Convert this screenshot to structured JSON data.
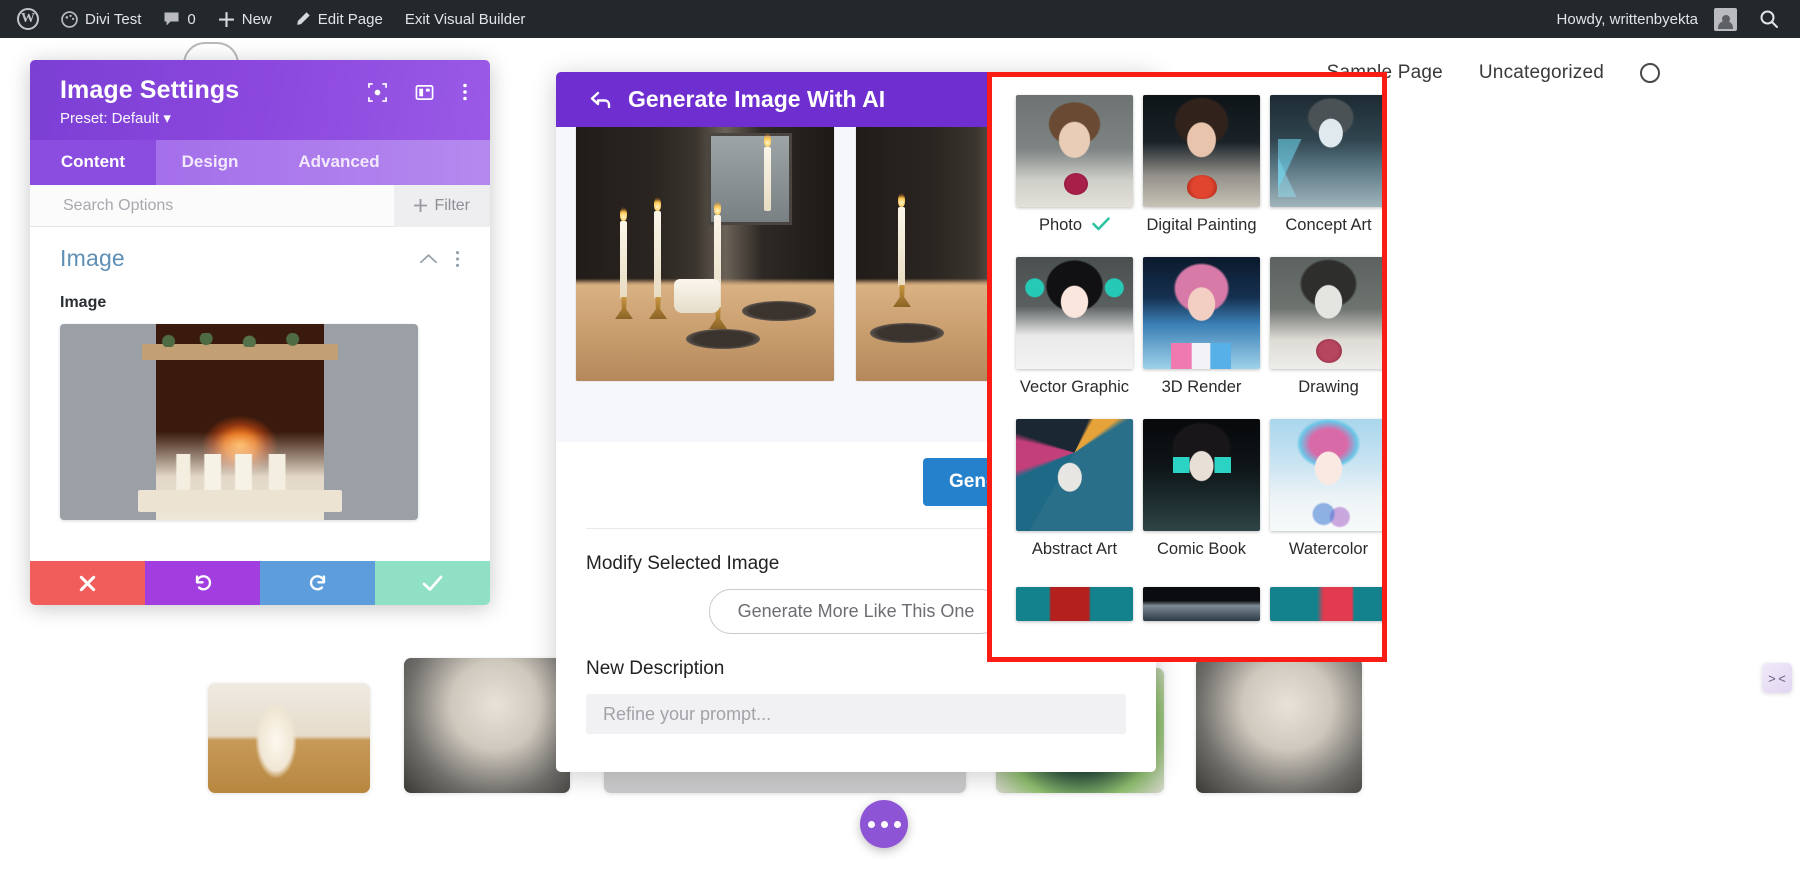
{
  "adminbar": {
    "wp_logo": "wordpress-logo-icon",
    "site_name": "Divi Test",
    "comments_icon": "comment-bubble-icon",
    "comments_count": "0",
    "new_icon": "plus-icon",
    "new_label": "New",
    "edit_icon": "pencil-icon",
    "edit_label": "Edit Page",
    "exit_label": "Exit Visual Builder",
    "howdy": "Howdy, writtenbyekta",
    "avatar": "user-avatar-icon",
    "search_icon": "search-icon"
  },
  "site": {
    "nav": [
      "Sample Page",
      "Uncategorized"
    ],
    "search_icon": "search-icon"
  },
  "divi_panel": {
    "title": "Image Settings",
    "preset": "Preset: Default",
    "preset_caret": "caret-down-icon",
    "header_icons": [
      "focus-target-icon",
      "layout-columns-icon",
      "kebab-menu-icon"
    ],
    "tabs": [
      {
        "label": "Content",
        "active": true
      },
      {
        "label": "Design",
        "active": false
      },
      {
        "label": "Advanced",
        "active": false
      }
    ],
    "search_placeholder": "Search Options",
    "filter_label": "Filter",
    "filter_icon": "plus-icon",
    "group_title": "Image",
    "group_collapse_icon": "chevron-up-icon",
    "group_menu_icon": "kebab-menu-icon",
    "field_label": "Image",
    "image_alt": "fireplace-with-candles-preview",
    "actions": [
      {
        "name": "cancel",
        "icon": "close-x-icon",
        "color": "#f05d5a"
      },
      {
        "name": "undo",
        "icon": "undo-arrow-icon",
        "color": "#a23ee0"
      },
      {
        "name": "redo",
        "icon": "redo-arrow-icon",
        "color": "#5d9ddb"
      },
      {
        "name": "save",
        "icon": "checkmark-icon",
        "color": "#8fe0c4"
      }
    ]
  },
  "ai_modal": {
    "back_icon": "back-arrow-icon",
    "title": "Generate Image With AI",
    "slides": [
      {
        "alt": "candlelit-dinner-table-1"
      },
      {
        "alt": "candlelit-dinner-table-2"
      }
    ],
    "generate_button": "Generate Four M",
    "modify_label": "Modify Selected Image",
    "more_like_this_button": "Generate More Like This One",
    "new_description_label": "New Description",
    "new_description_placeholder": "Refine your prompt...",
    "new_description_value": ""
  },
  "style_panel": {
    "highlight_color": "#f91d16",
    "selected_style": "Photo",
    "check_icon": "checkmark-icon",
    "styles": [
      {
        "label": "Photo",
        "thumb": "p-photo",
        "selected": true
      },
      {
        "label": "Digital Painting",
        "thumb": "p-digital",
        "selected": false
      },
      {
        "label": "Concept Art",
        "thumb": "p-concept",
        "selected": false
      },
      {
        "label": "Vector Graphic",
        "thumb": "p-vector",
        "selected": false
      },
      {
        "label": "3D Render",
        "thumb": "p-3d",
        "selected": false
      },
      {
        "label": "Drawing",
        "thumb": "p-drawing",
        "selected": false
      },
      {
        "label": "Abstract Art",
        "thumb": "p-abstract",
        "selected": false
      },
      {
        "label": "Comic Book",
        "thumb": "p-comic",
        "selected": false
      },
      {
        "label": "Watercolor",
        "thumb": "p-water",
        "selected": false
      }
    ],
    "partial_row": [
      {
        "label": "",
        "thumb": "p-r4a"
      },
      {
        "label": "",
        "thumb": "p-r4b"
      },
      {
        "label": "",
        "thumb": "p-r4c"
      }
    ]
  },
  "floating": {
    "fab_icon": "ellipsis-dots-icon",
    "edge_toggle_icon": "collapse-arrows-icon"
  },
  "background_thumbs": [
    {
      "alt": "pine-tree-candle-jar",
      "style": "candle-a"
    },
    {
      "alt": "pillar-candles-on-stone",
      "style": "candle-b"
    },
    {
      "alt": "white-bowl-plate",
      "style": "candle-c"
    },
    {
      "alt": "green-candle-with-plant",
      "style": "candle-d"
    }
  ]
}
